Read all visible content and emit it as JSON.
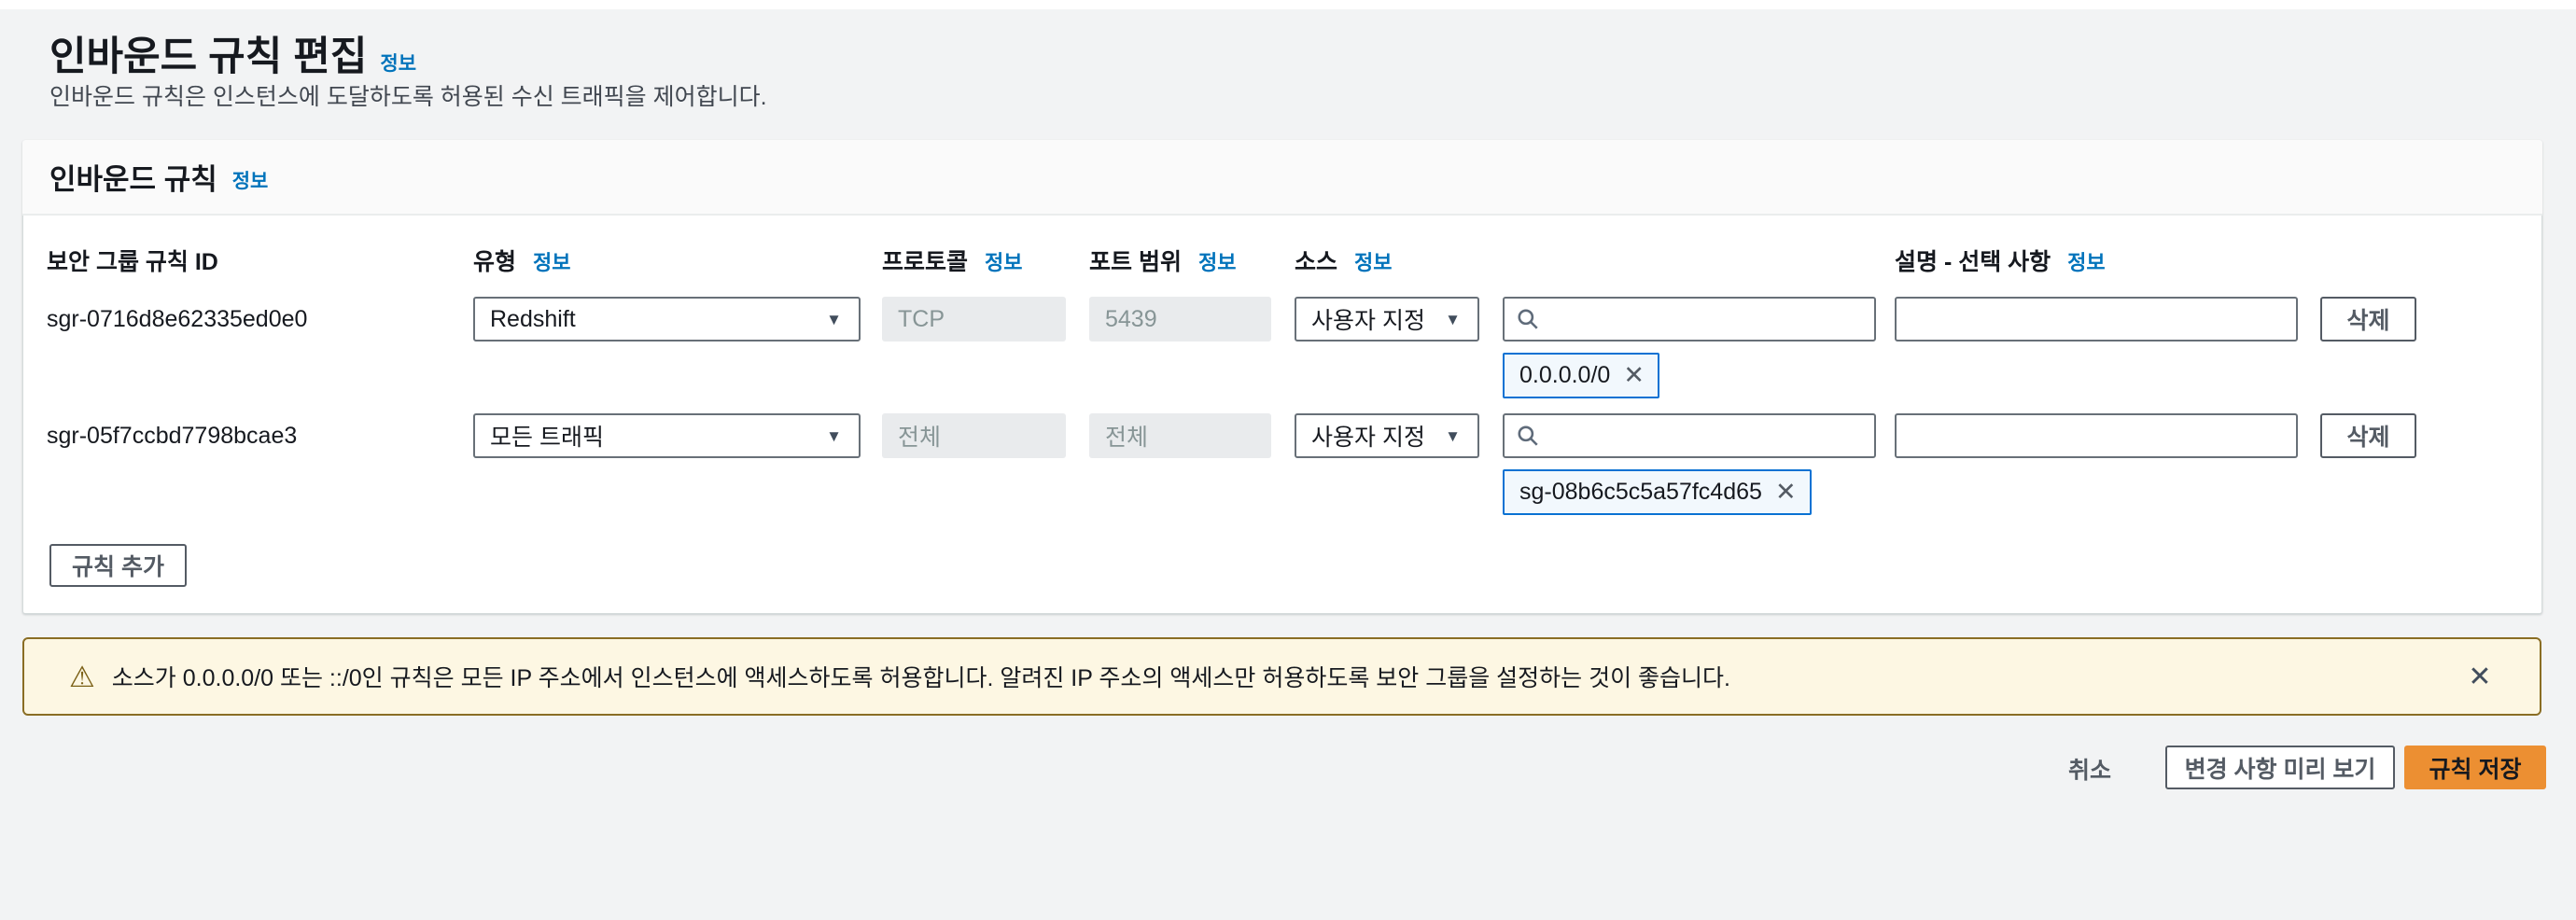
{
  "ui": {
    "info_label": "정보",
    "icons": {
      "caret": "▼",
      "close": "✕",
      "warning": "⚠",
      "search": "magnifier"
    },
    "colors": {
      "accent_orange": "#ec8f32",
      "link_blue": "#0073bb",
      "tag_border_blue": "#0972d3",
      "tag_bg": "#f2f8fd",
      "warning_bg": "#fdf7e3",
      "warning_border": "#8a6d24",
      "disabled_input_bg": "#e9ebed"
    }
  },
  "page": {
    "title": "인바운드 규칙 편집",
    "subtitle": "인바운드 규칙은 인스턴스에 도달하도록 허용된 수신 트래픽을 제어합니다."
  },
  "panel": {
    "header": "인바운드 규칙",
    "columns": {
      "rule_id": "보안 그룹 규칙 ID",
      "type": "유형",
      "protocol": "프로토콜",
      "port_range": "포트 범위",
      "source": "소스",
      "description": "설명 - 선택 사항"
    },
    "rules": [
      {
        "id": "sgr-0716d8e62335ed0e0",
        "type": "Redshift",
        "protocol": "TCP",
        "port": "5439",
        "source_mode": "사용자 지정",
        "source_search_value": "",
        "source_tag": "0.0.0.0/0",
        "description_value": "",
        "delete_label": "삭제"
      },
      {
        "id": "sgr-05f7ccbd7798bcae3",
        "type": "모든 트래픽",
        "protocol": "전체",
        "port": "전체",
        "source_mode": "사용자 지정",
        "source_search_value": "",
        "source_tag": "sg-08b6c5c5a57fc4d65",
        "description_value": "",
        "delete_label": "삭제"
      }
    ],
    "add_rule_label": "규칙 추가"
  },
  "warning": {
    "text": "소스가 0.0.0.0/0 또는 ::/0인 규칙은 모든 IP 주소에서 인스턴스에 액세스하도록 허용합니다. 알려진 IP 주소의 액세스만 허용하도록 보안 그룹을 설정하는 것이 좋습니다."
  },
  "footer": {
    "cancel": "취소",
    "preview": "변경 사항 미리 보기",
    "save": "규칙 저장"
  }
}
